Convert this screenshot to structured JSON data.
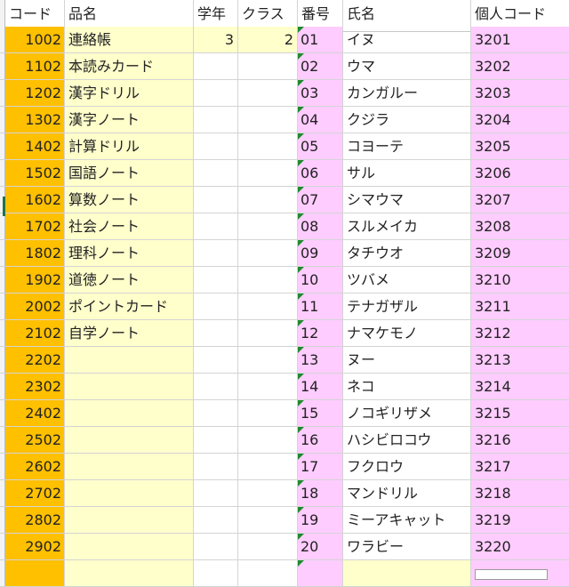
{
  "headers": [
    "コード",
    "品名",
    "学年",
    "クラス",
    "番号",
    "氏名",
    "個人コード"
  ],
  "rows": [
    {
      "code": "1002",
      "item": "連絡帳",
      "grade": "3",
      "class": "2",
      "no": "01",
      "name": "イヌ",
      "pcode": "3201"
    },
    {
      "code": "1102",
      "item": "本読みカード",
      "grade": "",
      "class": "",
      "no": "02",
      "name": "ウマ",
      "pcode": "3202"
    },
    {
      "code": "1202",
      "item": "漢字ドリル",
      "grade": "",
      "class": "",
      "no": "03",
      "name": "カンガルー",
      "pcode": "3203"
    },
    {
      "code": "1302",
      "item": "漢字ノート",
      "grade": "",
      "class": "",
      "no": "04",
      "name": "クジラ",
      "pcode": "3204"
    },
    {
      "code": "1402",
      "item": "計算ドリル",
      "grade": "",
      "class": "",
      "no": "05",
      "name": "コヨーテ",
      "pcode": "3205"
    },
    {
      "code": "1502",
      "item": "国語ノート",
      "grade": "",
      "class": "",
      "no": "06",
      "name": "サル",
      "pcode": "3206"
    },
    {
      "code": "1602",
      "item": "算数ノート",
      "grade": "",
      "class": "",
      "no": "07",
      "name": "シマウマ",
      "pcode": "3207"
    },
    {
      "code": "1702",
      "item": "社会ノート",
      "grade": "",
      "class": "",
      "no": "08",
      "name": "スルメイカ",
      "pcode": "3208"
    },
    {
      "code": "1802",
      "item": "理科ノート",
      "grade": "",
      "class": "",
      "no": "09",
      "name": "タチウオ",
      "pcode": "3209"
    },
    {
      "code": "1902",
      "item": "道徳ノート",
      "grade": "",
      "class": "",
      "no": "10",
      "name": "ツバメ",
      "pcode": "3210"
    },
    {
      "code": "2002",
      "item": "ポイントカード",
      "grade": "",
      "class": "",
      "no": "11",
      "name": "テナガザル",
      "pcode": "3211"
    },
    {
      "code": "2102",
      "item": "自学ノート",
      "grade": "",
      "class": "",
      "no": "12",
      "name": "ナマケモノ",
      "pcode": "3212"
    },
    {
      "code": "2202",
      "item": "",
      "grade": "",
      "class": "",
      "no": "13",
      "name": "ヌー",
      "pcode": "3213"
    },
    {
      "code": "2302",
      "item": "",
      "grade": "",
      "class": "",
      "no": "14",
      "name": "ネコ",
      "pcode": "3214"
    },
    {
      "code": "2402",
      "item": "",
      "grade": "",
      "class": "",
      "no": "15",
      "name": "ノコギリザメ",
      "pcode": "3215"
    },
    {
      "code": "2502",
      "item": "",
      "grade": "",
      "class": "",
      "no": "16",
      "name": "ハシビロコウ",
      "pcode": "3216"
    },
    {
      "code": "2602",
      "item": "",
      "grade": "",
      "class": "",
      "no": "17",
      "name": "フクロウ",
      "pcode": "3217"
    },
    {
      "code": "2702",
      "item": "",
      "grade": "",
      "class": "",
      "no": "18",
      "name": "マンドリル",
      "pcode": "3218"
    },
    {
      "code": "2802",
      "item": "",
      "grade": "",
      "class": "",
      "no": "19",
      "name": "ミーアキャット",
      "pcode": "3219"
    },
    {
      "code": "2902",
      "item": "",
      "grade": "",
      "class": "",
      "no": "20",
      "name": "ワラビー",
      "pcode": "3220"
    }
  ],
  "colors": {
    "code_fill": "#ffc000",
    "item_fill": "#ffffcc",
    "name_fill": "#ffccff",
    "error_triangle": "#1e8a2e"
  }
}
